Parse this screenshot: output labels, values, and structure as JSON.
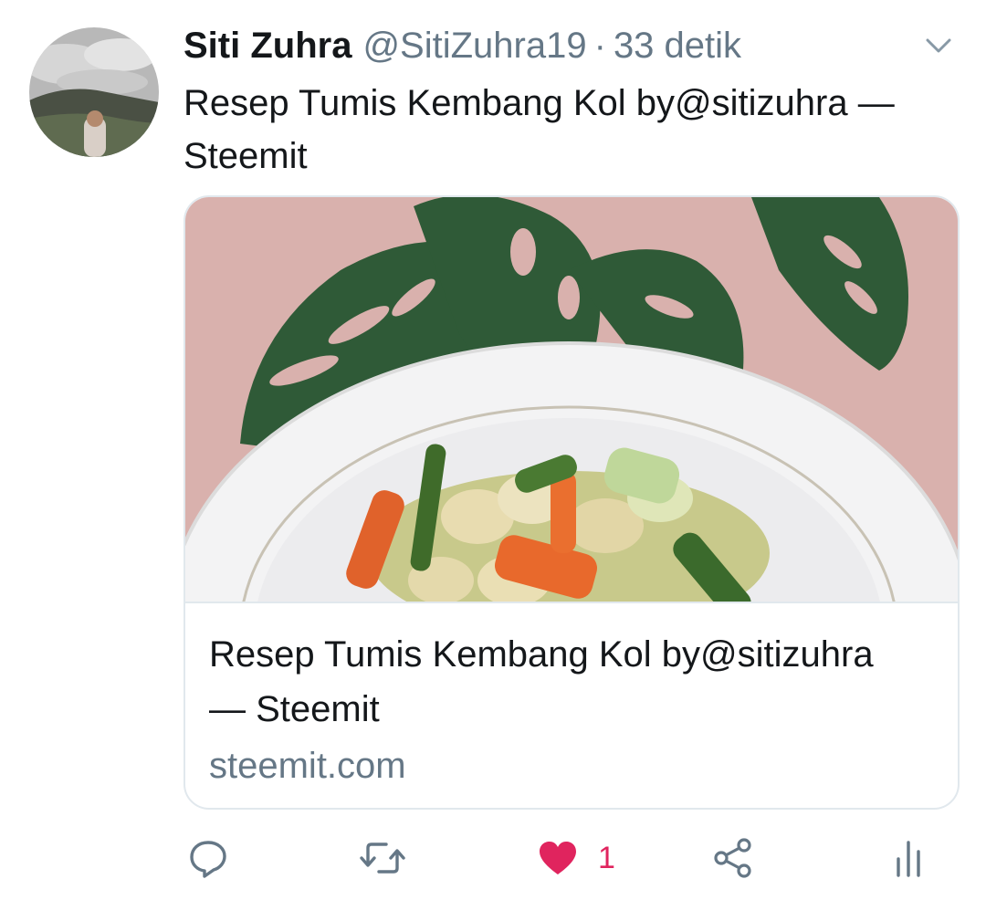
{
  "tweet": {
    "author_name": "Siti Zuhra",
    "handle": "@SitiZuhra19",
    "separator": "·",
    "time": "33 detik",
    "text": "Resep Tumis Kembang Kol by@sitizuhra — Steemit"
  },
  "card": {
    "title": "Resep Tumis Kembang Kol by@sitizuhra — Steemit",
    "domain": "steemit.com"
  },
  "actions": {
    "reply_icon": "reply-icon",
    "retweet_icon": "retweet-icon",
    "like_icon": "heart-icon",
    "like_count": "1",
    "share_icon": "share-icon",
    "analytics_icon": "analytics-icon"
  },
  "colors": {
    "text": "#14171a",
    "secondary": "#657786",
    "like": "#e0245e",
    "border": "#e1e8ed"
  }
}
